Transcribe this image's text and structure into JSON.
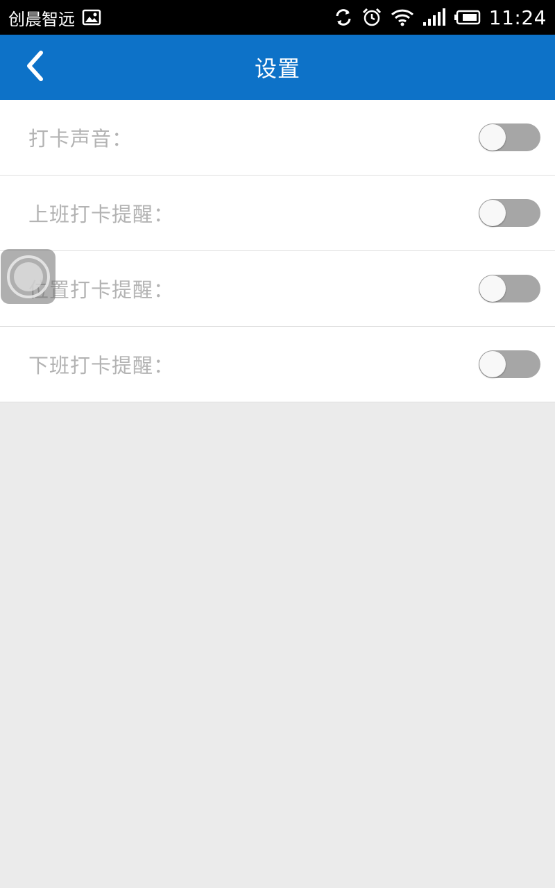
{
  "status_bar": {
    "app_name": "创晨智远",
    "time": "11:24",
    "icons": [
      "image-icon",
      "sync-icon",
      "alarm-icon",
      "wifi-icon",
      "signal-icon",
      "battery-icon"
    ]
  },
  "app_bar": {
    "title": "设置",
    "back_icon": "chevron-left-icon",
    "background": "#0d72c8"
  },
  "settings": [
    {
      "label": "打卡声音：",
      "enabled": false
    },
    {
      "label": "上班打卡提醒：",
      "enabled": false
    },
    {
      "label": "位置打卡提醒：",
      "enabled": false
    },
    {
      "label": "下班打卡提醒：",
      "enabled": false
    }
  ],
  "colors": {
    "page_background": "#ebebeb",
    "label_text": "#b3b3b3",
    "toggle_off": "#a6a6a6"
  }
}
